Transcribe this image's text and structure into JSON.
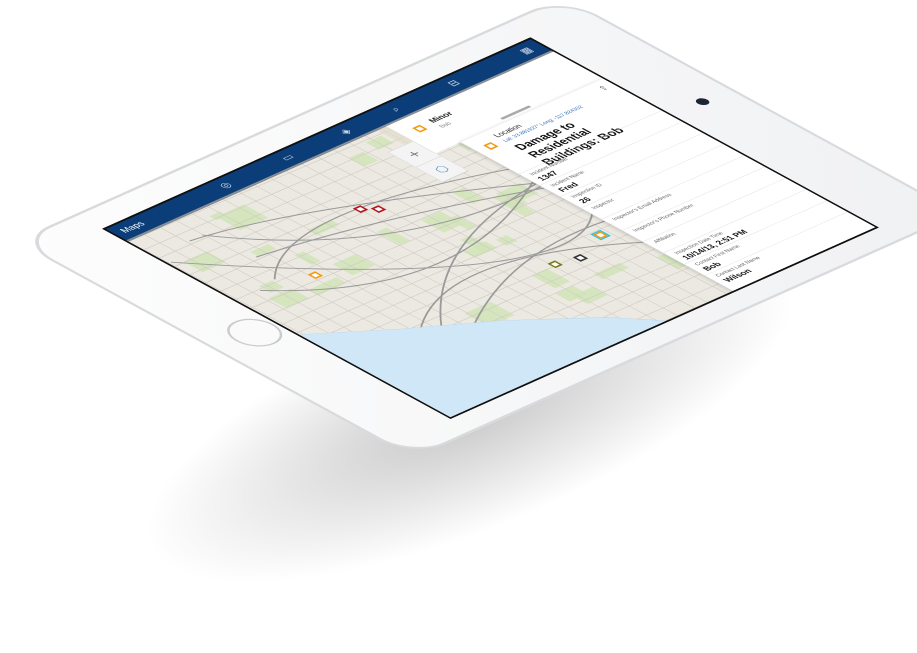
{
  "app": {
    "title": "Maps"
  },
  "toolbar": {
    "icons": [
      "basemap-icon",
      "bookmarks-icon",
      "layers-icon",
      "search-icon",
      "measure-icon",
      "qr-icon"
    ]
  },
  "map": {
    "zoom_in": "+",
    "markers": [
      {
        "color": "#b3121a",
        "type": "major"
      },
      {
        "color": "#b3121a",
        "type": "major"
      },
      {
        "color": "#f29a12",
        "type": "minor"
      },
      {
        "color": "#f29a12",
        "type": "selected",
        "highlight": "#29c1e8"
      },
      {
        "color": "#333333",
        "type": "other"
      },
      {
        "color": "#7a7a1a",
        "type": "other"
      }
    ],
    "water_color": "#cfe7f7",
    "land_color": "#ece9e2"
  },
  "popup": {
    "severity": "Minor",
    "name": "Bob"
  },
  "detail": {
    "location_label": "Location",
    "coordinates": "Lat: 33.881927° Long: -117.824302",
    "title": "Damage to Residential Buildings: Bob",
    "fields": [
      {
        "label": "Incident Number",
        "value": "1347"
      },
      {
        "label": "Incident Name",
        "value": "Fred"
      },
      {
        "label": "Inspection ID",
        "value": "26"
      },
      {
        "label": "Inspector",
        "value": ""
      },
      {
        "label": "Inspector's Email Address",
        "value": ""
      },
      {
        "label": "Inspector's Phone Number",
        "value": ""
      },
      {
        "label": "Affiliation",
        "value": ""
      },
      {
        "label": "Inspection Date Time",
        "value": "10/14/13, 2:51 PM"
      },
      {
        "label": "Contact First Name",
        "value": "Bob"
      },
      {
        "label": "Contact Last Name",
        "value": "Wilson"
      }
    ]
  },
  "colors": {
    "accent": "#0b3d78",
    "minor": "#f29a12",
    "major": "#b3121a"
  }
}
